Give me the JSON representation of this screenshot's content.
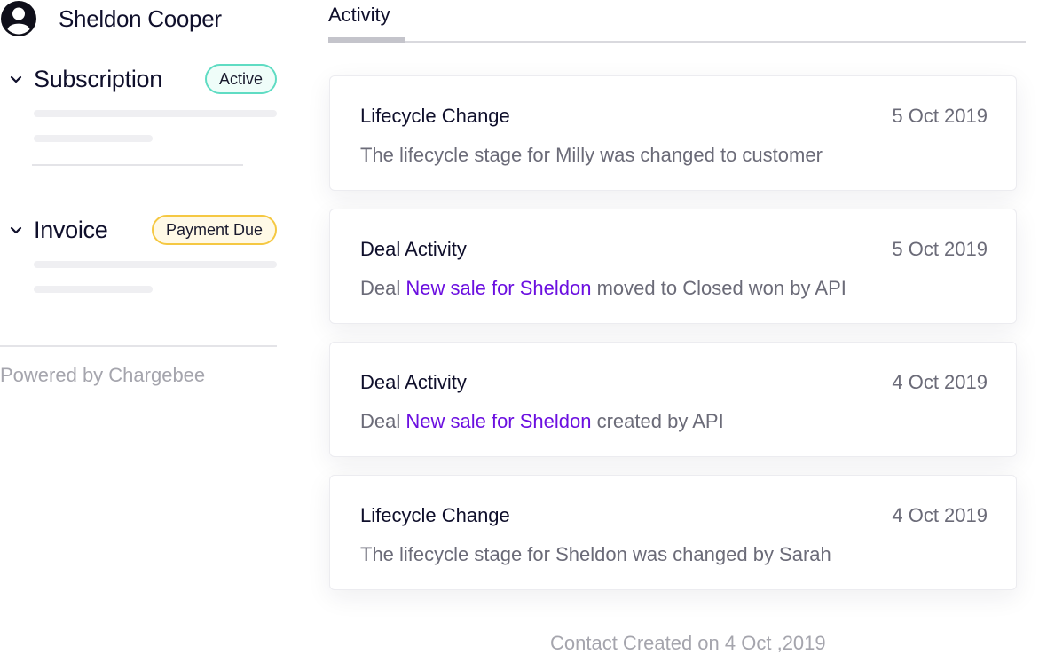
{
  "profile": {
    "name": "Sheldon Cooper",
    "avatar_icon": "user-circle-icon"
  },
  "sections": {
    "subscription": {
      "title": "Subscription",
      "badge": "Active",
      "badge_color": "#5fdcc3"
    },
    "invoice": {
      "title": "Invoice",
      "badge": "Payment Due",
      "badge_color": "#f5c842"
    }
  },
  "powered_by": "Powered by Chargebee",
  "tabs": {
    "activity": "Activity"
  },
  "activities": [
    {
      "title": "Lifecycle Change",
      "date": "5 Oct 2019",
      "description": "The lifecycle stage for Milly was changed to customer"
    },
    {
      "title": "Deal Activity",
      "date": "5 Oct 2019",
      "prefix": "Deal ",
      "link": "New sale for Sheldon",
      "suffix": " moved to Closed won by API"
    },
    {
      "title": "Deal Activity",
      "date": "4 Oct 2019",
      "prefix": "Deal ",
      "link": "New sale for Sheldon",
      "suffix": " created by API"
    },
    {
      "title": "Lifecycle Change",
      "date": "4 Oct 2019",
      "description": "The lifecycle stage for Sheldon was changed by Sarah"
    }
  ],
  "footer": "Contact Created on 4 Oct ,2019",
  "colors": {
    "link": "#6b0fe0",
    "muted_text": "#6b6b78",
    "heading": "#0f0f2b"
  }
}
